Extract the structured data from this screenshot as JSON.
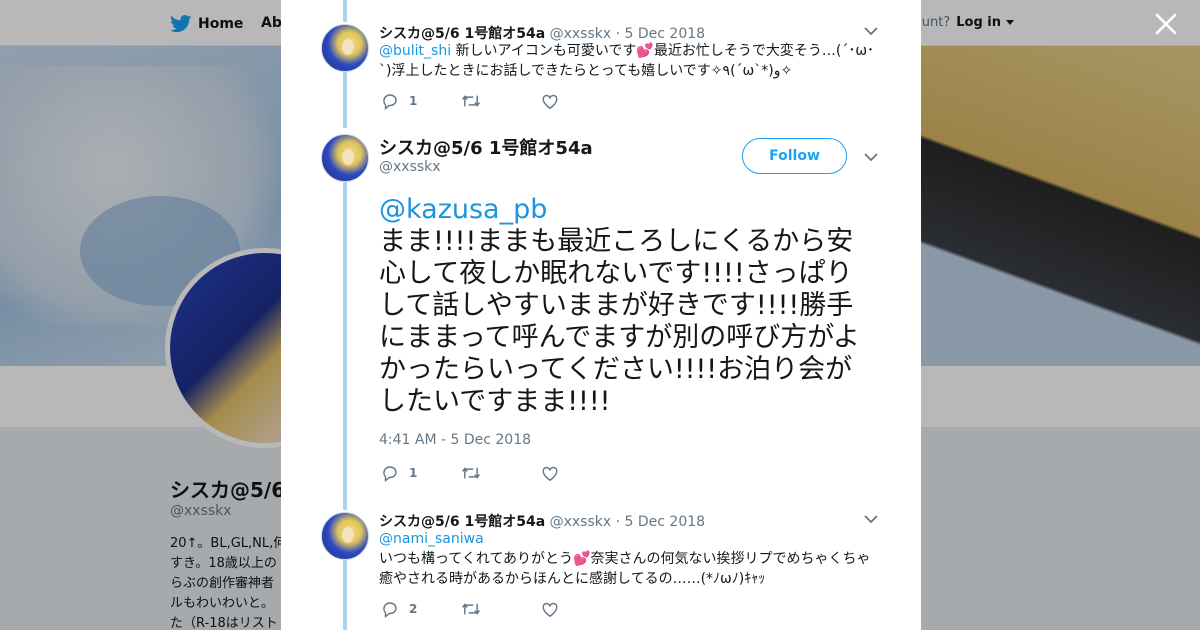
{
  "topnav": {
    "home_label": "Home",
    "about_label": "Abo",
    "account_text": "account?",
    "login_label": "Log in"
  },
  "profile": {
    "name": "シスカ@5/6",
    "handle": "@xxsskx",
    "bio_lines": [
      "20↑。BL,GL,NL,何",
      "すき。18歳以上の",
      "らぶの創作審神者",
      "ルもわいわいと。",
      "た（R-18はリスト"
    ]
  },
  "tweets": [
    {
      "name": "シスカ@5/6 1号館オ54a",
      "handle": "@xxsskx",
      "date": "5 Dec 2018",
      "mention": "@bulit_shi",
      "text": " 新しいアイコンも可愛いです💕最近お忙しそうで大変そう…(´･ω･`)浮上したときにお話しできたらとっても嬉しいです✧٩(ˊωˋ*)و✧",
      "replies": "1"
    },
    {
      "name": "シスカ@5/6 1号館オ54a",
      "handle": "@xxsskx",
      "follow_label": "Follow",
      "mention": "@kazusa_pb",
      "text": "まま!!!!ままも最近ころしにくるから安心して夜しか眠れないです!!!!さっぱりして話しやすいままが好きです!!!!勝手にままって呼んでますが別の呼び方がよかったらいってください!!!!お泊り会がしたいですまま!!!!",
      "timestamp": "4:41 AM - 5 Dec 2018",
      "replies": "1"
    },
    {
      "name": "シスカ@5/6 1号館オ54a",
      "handle": "@xxsskx",
      "date": "5 Dec 2018",
      "mention": "@nami_saniwa",
      "text": "いつも構ってくれてありがとう💕奈実さんの何気ない挨拶リプでめちゃくちゃ癒やされる時があるからほんとに感謝してるの……(*ﾉωﾉ)ｷｬｯ",
      "replies": "2"
    }
  ],
  "colors": {
    "accent": "#1da1f2",
    "mention": "#1b95e0",
    "thread_line": "#a6d4f2",
    "muted": "#657786"
  },
  "icons": [
    "twitter-bird-icon",
    "close-icon",
    "chevron-down-icon",
    "reply-icon",
    "retweet-icon",
    "like-icon"
  ]
}
